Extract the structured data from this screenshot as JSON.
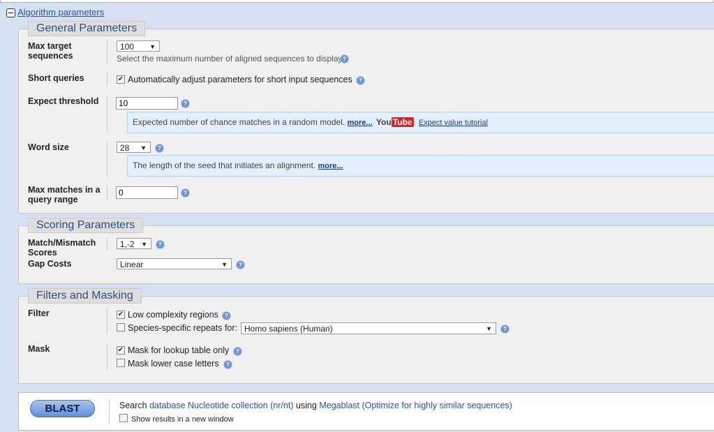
{
  "section": {
    "title": "Algorithm parameters"
  },
  "general": {
    "legend": "General Parameters",
    "max_target": {
      "label": "Max target sequences",
      "value": "100",
      "hint": "Select the maximum number of aligned sequences to display"
    },
    "short_queries": {
      "label": "Short queries",
      "checked": true,
      "text": "Automatically adjust parameters for short input sequences"
    },
    "expect": {
      "label": "Expect threshold",
      "value": "10",
      "info": "Expected number of chance matches in a random model.",
      "more": "more...",
      "youtube": "YouTube",
      "tutorial": "Expect value tutorial"
    },
    "word_size": {
      "label": "Word size",
      "value": "28",
      "info": "The length of the seed that initiates an alignment.",
      "more": "more..."
    },
    "max_matches": {
      "label": "Max matches in a query range",
      "value": "0"
    }
  },
  "scoring": {
    "legend": "Scoring Parameters",
    "match": {
      "label": "Match/Mismatch Scores",
      "value": "1,-2"
    },
    "gap": {
      "label": "Gap Costs",
      "value": "Linear"
    }
  },
  "filters": {
    "legend": "Filters and Masking",
    "filter_label": "Filter",
    "low_complexity": "Low complexity regions",
    "species": "Species-specific repeats for:",
    "species_value": "Homo sapiens (Human)",
    "mask_label": "Mask",
    "lookup": "Mask for lookup table only",
    "lowercase": "Mask lower case letters"
  },
  "submit": {
    "button": "BLAST",
    "search": "Search",
    "database": "database Nucleotide collection (nr/nt)",
    "using": "using",
    "program": "Megablast (Optimize for highly similar sequences)",
    "new_window": "Show results in a new window"
  },
  "icons": {
    "help": "help-icon",
    "collapse": "minus-icon"
  }
}
